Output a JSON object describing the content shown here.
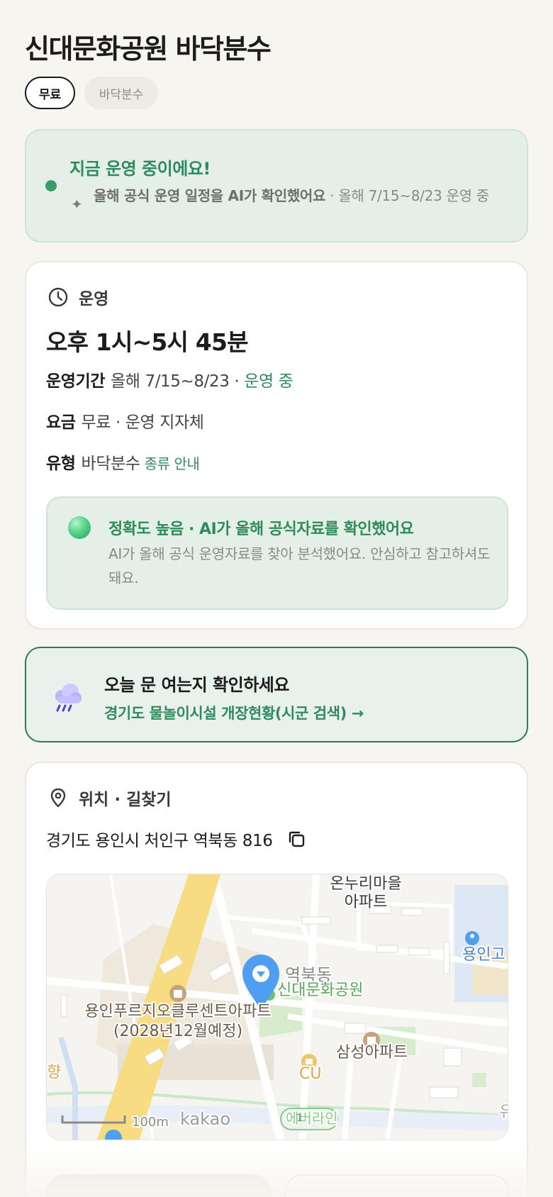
{
  "header": {
    "title": "신대문화공원 바닥분수",
    "chips": [
      "무료",
      "바닥분수"
    ]
  },
  "status": {
    "headline": "지금 운영 중이에요!",
    "ai_note": "올해 공식 운영 일정을 AI가 확인했어요",
    "ai_suffix": " · 올해 7/15~8/23 운영 중"
  },
  "operation": {
    "section_label": "운영",
    "hours": "오후 1시~5시 45분",
    "period_label": "운영기간",
    "period_value": "올해 7/15~8/23 · ",
    "period_status": "운영 중",
    "fee_label": "요금",
    "fee_value": "무료 · 운영 지자체",
    "type_label": "유형",
    "type_value": "바닥분수",
    "type_link": "종류 안내",
    "accuracy": {
      "headline": "정확도 높음 · AI가 올해 공식자료를 확인했어요",
      "body": "AI가 올해 공식 운영자료를 찾아 분석했어요. 안심하고 참고하셔도 돼요."
    }
  },
  "notice": {
    "headline": "오늘 문 여는지 확인하세요",
    "link": "경기도 물놀이시설 개장현황(시군 검색) →"
  },
  "location": {
    "section_label": "위치 · 길찾기",
    "address": "경기도 용인시 처인구 역북동 816",
    "map": {
      "labels": {
        "apt1_line1": "온누리마을",
        "apt1_line2": "아파트",
        "school": "용인고",
        "dong": "역북동",
        "park": "신대문화공원",
        "apt2_line1": "용인푸르지오클루센트아파트",
        "apt2_line2": "(2028년12월예정)",
        "apt3": "삼성아파트",
        "store": "CU",
        "left_edge": "향",
        "right_edge": "유",
        "route": "에버라인",
        "route_no": "1",
        "scale": "100m",
        "brand": "kakao"
      }
    }
  },
  "colors": {
    "accent": "#2f8a5c",
    "background": "#f7f5f0",
    "status_bg": "#e4efe8",
    "pin": "#4f9ef0"
  }
}
